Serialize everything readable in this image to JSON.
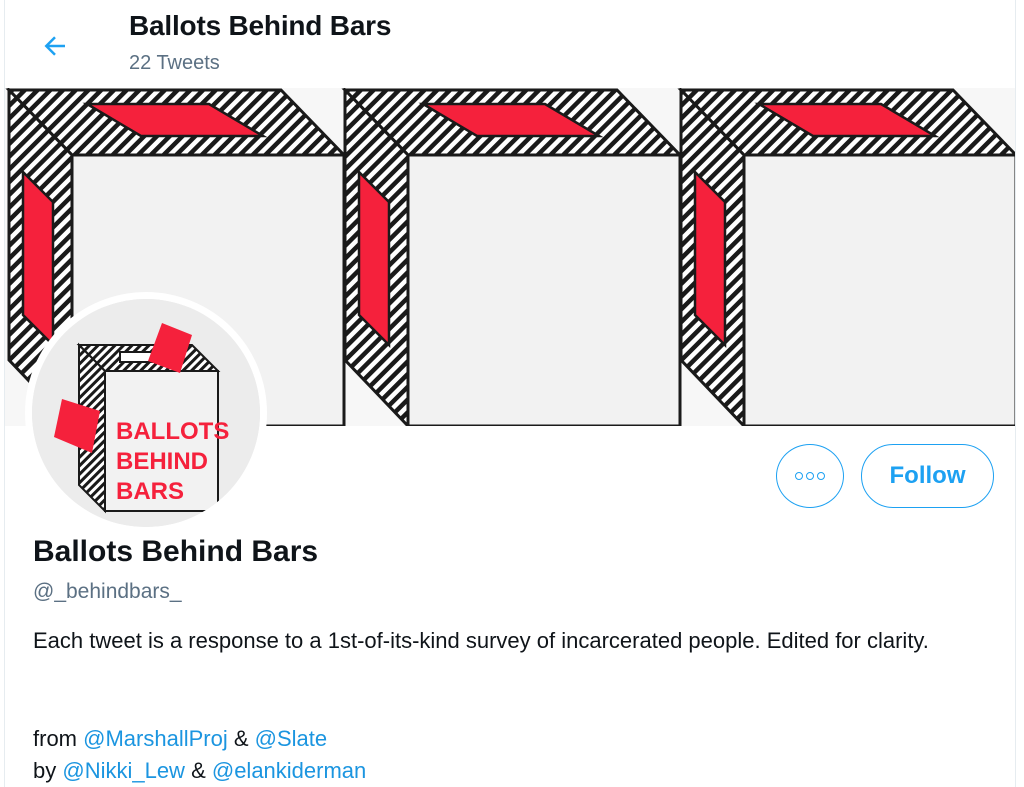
{
  "header": {
    "title": "Ballots Behind Bars",
    "tweet_count": "22 Tweets",
    "back_icon": "arrow-left-icon"
  },
  "colors": {
    "accent": "#1da1f2",
    "link": "#1b95e0",
    "brand_red": "#f5213c",
    "text_primary": "#0f1419",
    "text_secondary": "#5b7083"
  },
  "avatar": {
    "logo_lines": [
      "BALLOTS",
      "BEHIND",
      "BARS"
    ]
  },
  "actions": {
    "more_icon": "more-horizontal-icon",
    "follow_label": "Follow"
  },
  "profile": {
    "name": "Ballots Behind Bars",
    "handle": "@_behindbars_",
    "bio": "Each tweet is a response to a 1st-of-its-kind survey of incarcerated people. Edited for clarity.",
    "from_prefix": "from ",
    "from_link_1": "@MarshallProj",
    "from_sep": " & ",
    "from_link_2": "@Slate",
    "by_prefix": "by ",
    "by_link_1": "@Nikki_Lew",
    "by_sep": " & ",
    "by_link_2": "@elankiderman"
  }
}
